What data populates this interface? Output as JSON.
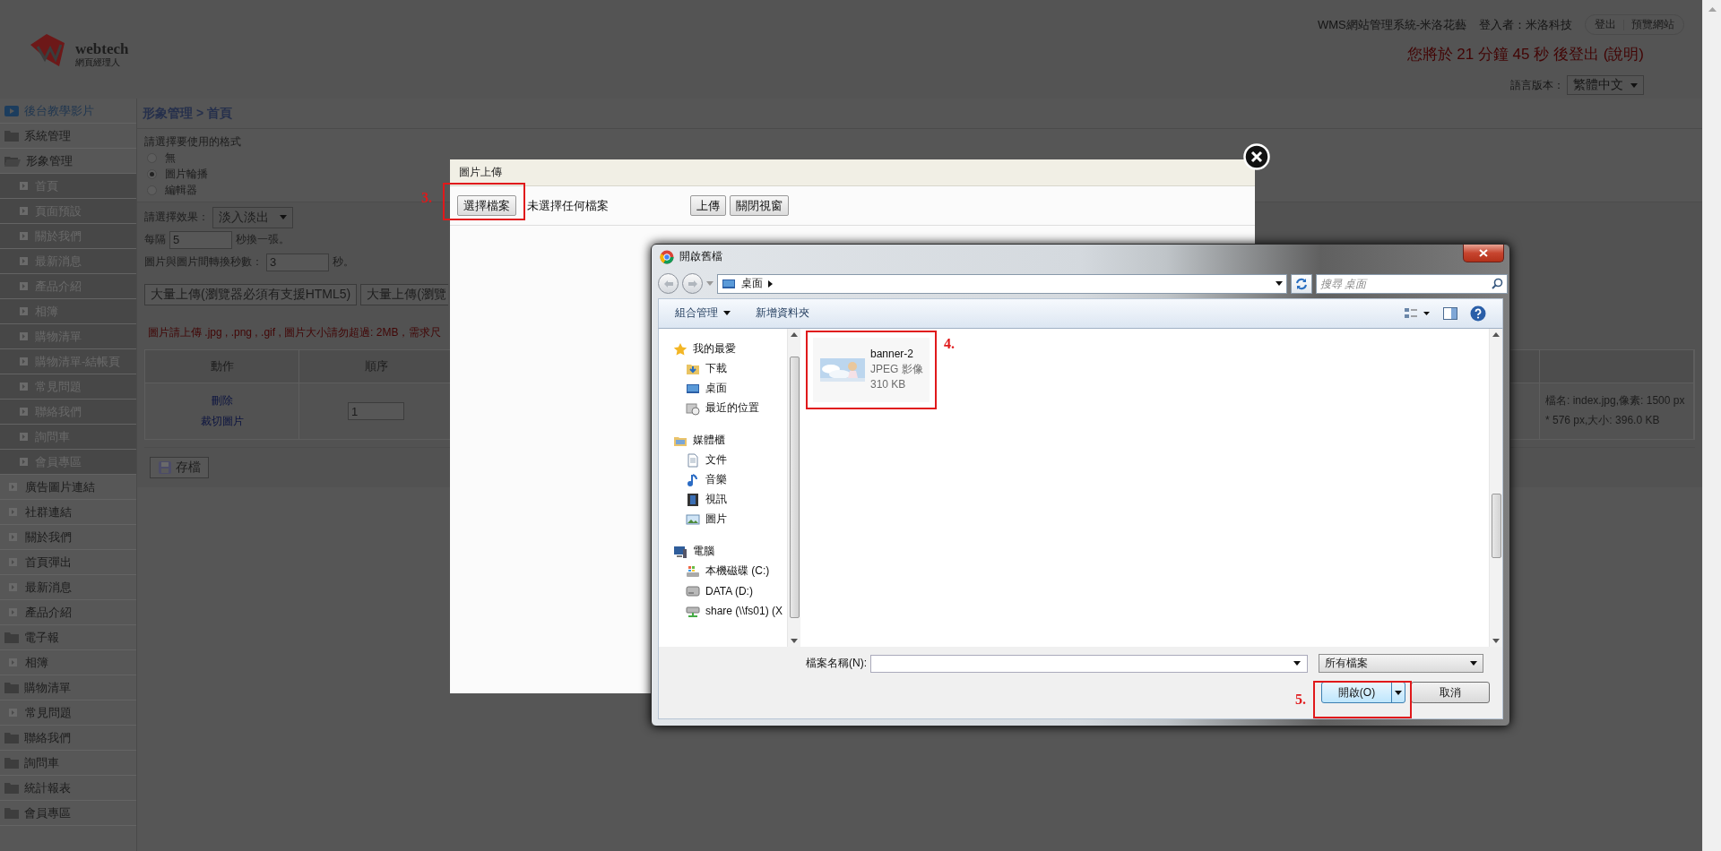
{
  "header": {
    "logo": {
      "name": "webtech",
      "tagline": "網頁經理人"
    },
    "system_title": "WMS網站管理系統-米洛花藝",
    "login_label": "登入者：米洛科技",
    "buttons": [
      "登出",
      "預覽網站"
    ],
    "timer": "您將於 21 分鐘 45 秒 後登出 (說明)",
    "language_label": "語言版本：",
    "language": "繁體中文"
  },
  "sidebar": {
    "items": [
      {
        "label": "後台教學影片",
        "kind": "video"
      },
      {
        "label": "系統管理",
        "kind": "folder",
        "expanded": false
      },
      {
        "label": "形象管理",
        "kind": "folder",
        "expanded": true,
        "children": [
          {
            "label": "首頁",
            "kind": "page"
          },
          {
            "label": "頁面預設",
            "kind": "page"
          },
          {
            "label": "關於我們",
            "kind": "page"
          },
          {
            "label": "最新消息",
            "kind": "page"
          },
          {
            "label": "產品介紹",
            "kind": "page"
          },
          {
            "label": "相簿",
            "kind": "page"
          },
          {
            "label": "購物清單",
            "kind": "page"
          },
          {
            "label": "購物清單-結帳頁",
            "kind": "page"
          },
          {
            "label": "常見問題",
            "kind": "page"
          },
          {
            "label": "聯絡我們",
            "kind": "page"
          },
          {
            "label": "詢問車",
            "kind": "page"
          },
          {
            "label": "會員專區",
            "kind": "page"
          }
        ]
      },
      {
        "label": "廣告圖片連結",
        "kind": "page"
      },
      {
        "label": "社群連結",
        "kind": "page"
      },
      {
        "label": "關於我們",
        "kind": "page"
      },
      {
        "label": "首頁彈出",
        "kind": "page"
      },
      {
        "label": "最新消息",
        "kind": "page"
      },
      {
        "label": "產品介紹",
        "kind": "page"
      },
      {
        "label": "電子報",
        "kind": "folder",
        "expanded": false
      },
      {
        "label": "相簿",
        "kind": "page"
      },
      {
        "label": "購物清單",
        "kind": "folder",
        "expanded": false
      },
      {
        "label": "常見問題",
        "kind": "page"
      },
      {
        "label": "聯絡我們",
        "kind": "folder",
        "expanded": false
      },
      {
        "label": "詢問車",
        "kind": "folder",
        "expanded": false
      },
      {
        "label": "統計報表",
        "kind": "folder",
        "expanded": false
      },
      {
        "label": "會員專區",
        "kind": "folder",
        "expanded": false
      }
    ]
  },
  "main": {
    "breadcrumb": "形象管理 > 首頁",
    "format": {
      "label": "請選擇要使用的格式",
      "options": [
        {
          "label": "無",
          "selected": false
        },
        {
          "label": "圖片輪播",
          "selected": true
        },
        {
          "label": "編輯器",
          "selected": false
        }
      ]
    },
    "effect": {
      "label": "請選擇效果：",
      "value": "淡入淡出"
    },
    "interval": {
      "before": "每隔",
      "value": "5",
      "after": "秒換一張。"
    },
    "transition": {
      "before": "圖片與圖片間轉換秒數：",
      "value": "3",
      "after": "秒。"
    },
    "bulk_buttons": [
      "大量上傳(瀏覽器必須有支援HTML5)",
      "大量上傳(瀏覽"
    ],
    "notice": "圖片請上傳 .jpg , .png , .gif , 圖片大小請勿超過: 2MB，需求尺",
    "table": {
      "columns": [
        "動作",
        "順序"
      ],
      "rows": [
        {
          "actions": [
            "刪除",
            "裁切圖片"
          ],
          "order": "1",
          "info": "檔名: index.jpg,像素: 1500 px * 576 px,大小: 396.0 KB"
        }
      ]
    },
    "save_button": "存檔"
  },
  "upload_modal": {
    "title": "圖片上傳",
    "choose_button": "選擇檔案",
    "file_status": "未選擇任何檔案",
    "buttons": [
      "上傳",
      "關閉視窗"
    ],
    "annotation": "3."
  },
  "file_dialog": {
    "title": "開啟舊檔",
    "location": "桌面",
    "search_placeholder": "搜尋 桌面",
    "toolbar": [
      "組合管理",
      "新增資料夾"
    ],
    "nav": [
      {
        "label": "我的最愛",
        "kind": "favorites",
        "children": [
          {
            "label": "下載",
            "kind": "download"
          },
          {
            "label": "桌面",
            "kind": "desktop"
          },
          {
            "label": "最近的位置",
            "kind": "recent"
          }
        ]
      },
      {
        "label": "媒體櫃",
        "kind": "library",
        "children": [
          {
            "label": "文件",
            "kind": "document"
          },
          {
            "label": "音樂",
            "kind": "music"
          },
          {
            "label": "視訊",
            "kind": "video"
          },
          {
            "label": "圖片"
          }
        ]
      },
      {
        "label": "電腦",
        "kind": "computer",
        "children": [
          {
            "label": "本機磁碟 (C:)",
            "kind": "system-drive"
          },
          {
            "label": "DATA (D:)",
            "kind": "drive"
          },
          {
            "label": "share (\\\\fs01) (X",
            "kind": "network-drive"
          }
        ]
      }
    ],
    "files": [
      {
        "name": "banner-2",
        "type": "JPEG 影像",
        "size": "310 KB",
        "kind": "picture"
      }
    ],
    "file_annotation": "4.",
    "filename_label": "檔案名稱(N):",
    "filter": "所有檔案",
    "open_button": "開啟(O)",
    "cancel_button": "取消",
    "open_annotation": "5."
  }
}
